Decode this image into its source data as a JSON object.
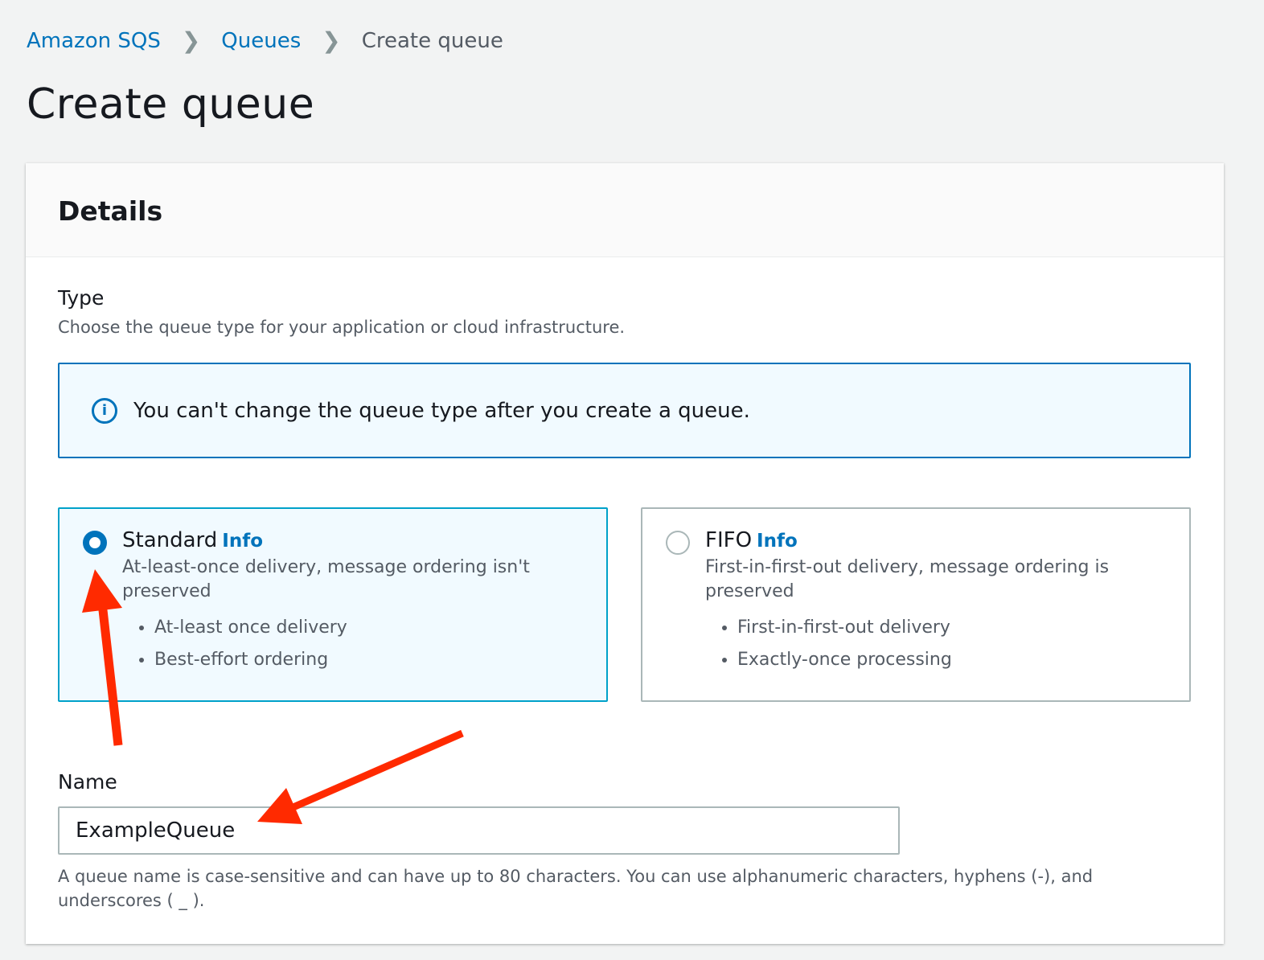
{
  "breadcrumb": {
    "items": [
      "Amazon SQS",
      "Queues"
    ],
    "current": "Create queue"
  },
  "page_title": "Create queue",
  "details": {
    "title": "Details",
    "type_label": "Type",
    "type_desc": "Choose the queue type for your application or cloud infrastructure.",
    "alert": "You can't change the queue type after you create a queue.",
    "options": [
      {
        "title": "Standard",
        "info": "Info",
        "selected": true,
        "desc": "At-least-once delivery, message ordering isn't preserved",
        "bullets": [
          "At-least once delivery",
          "Best-effort ordering"
        ]
      },
      {
        "title": "FIFO",
        "info": "Info",
        "selected": false,
        "desc": "First-in-first-out delivery, message ordering is preserved",
        "bullets": [
          "First-in-first-out delivery",
          "Exactly-once processing"
        ]
      }
    ],
    "name_label": "Name",
    "name_value": "ExampleQueue",
    "name_hint": "A queue name is case-sensitive and can have up to 80 characters. You can use alphanumeric characters, hyphens (-), and underscores ( _ )."
  },
  "colors": {
    "accent": "#0073bb",
    "annotation": "#ff2a00"
  }
}
